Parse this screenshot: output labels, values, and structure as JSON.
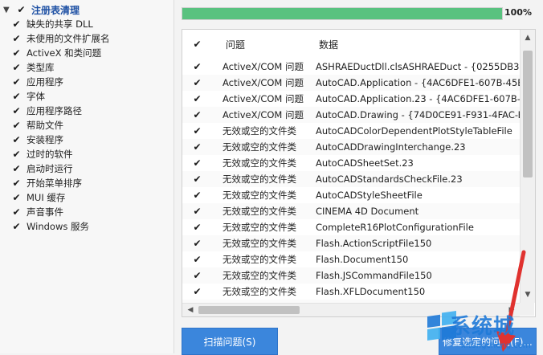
{
  "category_panel": {
    "header": "注册表清理",
    "items": [
      "缺失的共享 DLL",
      "未使用的文件扩展名",
      "ActiveX 和类问题",
      "类型库",
      "应用程序",
      "字体",
      "应用程序路径",
      "帮助文件",
      "安装程序",
      "过时的软件",
      "启动时运行",
      "开始菜单排序",
      "MUI 缓存",
      "声音事件",
      "Windows 服务"
    ]
  },
  "progress": {
    "percent_label": "100%",
    "value": 100,
    "color": "#59c27f"
  },
  "table": {
    "columns": [
      "问题",
      "数据"
    ],
    "rows": [
      {
        "issue": "ActiveX/COM 问题",
        "data": "ASHRAEDuctDll.clsASHRAEDuct - {0255DB3B-CBC0-4"
      },
      {
        "issue": "ActiveX/COM 问题",
        "data": "AutoCAD.Application - {4AC6DFE1-607B-45B2-B289-"
      },
      {
        "issue": "ActiveX/COM 问题",
        "data": "AutoCAD.Application.23 - {4AC6DFE1-607B-45B2-B289-"
      },
      {
        "issue": "ActiveX/COM 问题",
        "data": "AutoCAD.Drawing - {74D0CE91-F931-4FAC-BEA9-EE"
      },
      {
        "issue": "无效或空的文件类",
        "data": "AutoCADColorDependentPlotStyleTableFile"
      },
      {
        "issue": "无效或空的文件类",
        "data": "AutoCADDrawingInterchange.23"
      },
      {
        "issue": "无效或空的文件类",
        "data": "AutoCADSheetSet.23"
      },
      {
        "issue": "无效或空的文件类",
        "data": "AutoCADStandardsCheckFile.23"
      },
      {
        "issue": "无效或空的文件类",
        "data": "AutoCADStyleSheetFile"
      },
      {
        "issue": "无效或空的文件类",
        "data": "CINEMA 4D Document"
      },
      {
        "issue": "无效或空的文件类",
        "data": "CompleteR16PlotConfigurationFile"
      },
      {
        "issue": "无效或空的文件类",
        "data": "Flash.ActionScriptFile150"
      },
      {
        "issue": "无效或空的文件类",
        "data": "Flash.Document150"
      },
      {
        "issue": "无效或空的文件类",
        "data": "Flash.JSCommandFile150"
      },
      {
        "issue": "无效或空的文件类",
        "data": "Flash.XFLDocument150"
      },
      {
        "issue": "无效或空的文件类",
        "data": "Hangouts"
      }
    ]
  },
  "buttons": {
    "scan": "扫描问题(S)",
    "fix": "修复选定的问题(F)..."
  },
  "watermark": {
    "text": "系统城",
    "url": "xitongcheng.com",
    "color": "#1f7ad8"
  },
  "arrow_color": "#e0322f",
  "check_glyph": "✔",
  "icons": {
    "expander": "triangle-down-icon",
    "check": "checkmark-icon",
    "scroll_up": "scroll-up-arrow-icon",
    "scroll_down": "scroll-down-arrow-icon",
    "scroll_left": "scroll-left-arrow-icon",
    "scroll_right": "scroll-right-arrow-icon",
    "watermark_logo": "windows-logo-icon",
    "arrow": "red-arrow-icon"
  }
}
